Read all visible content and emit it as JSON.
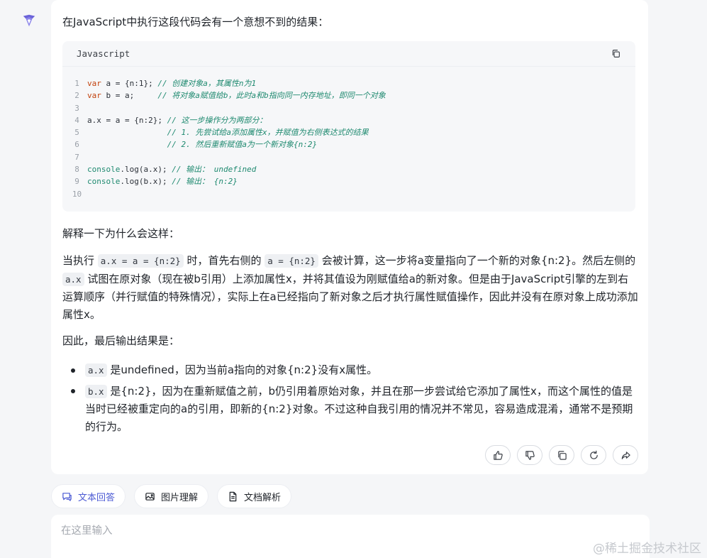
{
  "intro": "在JavaScript中执行这段代码会有一个意想不到的结果：",
  "code": {
    "language": "Javascript",
    "lines": [
      {
        "n": "1",
        "kw": "var",
        "code": " a = {n:1}; ",
        "comment": "// 创建对象a，其属性n为1"
      },
      {
        "n": "2",
        "kw": "var",
        "code": " b = a;     ",
        "comment": "// 将对象a赋值给b，此时a和b指向同一内存地址，即同一个对象"
      },
      {
        "n": "3",
        "kw": "",
        "code": "",
        "comment": ""
      },
      {
        "n": "4",
        "kw": "",
        "code": "a.x = a = {n:2}; ",
        "comment": "// 这一步操作分为两部分："
      },
      {
        "n": "5",
        "kw": "",
        "code": "                 ",
        "comment": "// 1. 先尝试给a添加属性x，并赋值为右侧表达式的结果"
      },
      {
        "n": "6",
        "kw": "",
        "code": "                 ",
        "comment": "// 2. 然后重新赋值a为一个新对象{n:2}"
      },
      {
        "n": "7",
        "kw": "",
        "code": "",
        "comment": ""
      },
      {
        "n": "8",
        "kw": "",
        "fn": "console",
        "code": ".log(a.x); ",
        "comment": "// 输出： undefined"
      },
      {
        "n": "9",
        "kw": "",
        "fn": "console",
        "code": ".log(b.x); ",
        "comment": "// 输出： {n:2}"
      },
      {
        "n": "10",
        "kw": "",
        "code": "",
        "comment": ""
      }
    ]
  },
  "explain_heading": "解释一下为什么会这样：",
  "para1": {
    "t1": "当执行 ",
    "c1": "a.x = a = {n:2}",
    "t2": " 时，首先右侧的 ",
    "c2": "a = {n:2}",
    "t3": " 会被计算，这一步将a变量指向了一个新的对象{n:2}。然后左侧的 ",
    "c3": "a.x",
    "t4": " 试图在原对象（现在被b引用）上添加属性x，并将其值设为刚赋值给a的新对象。但是由于JavaScript引擎的左到右运算顺序（并行赋值的特殊情况），实际上在a已经指向了新对象之后才执行属性赋值操作，因此并没有在原对象上成功添加属性x。"
  },
  "conclusion": "因此，最后输出结果是：",
  "bullets": [
    {
      "code": "a.x",
      "text": " 是undefined，因为当前a指向的对象{n:2}没有x属性。"
    },
    {
      "code": "b.x",
      "text": " 是{n:2}，因为在重新赋值之前，b仍引用着原始对象，并且在那一步尝试给它添加了属性x，而这个属性的值是当时已经被重定向的a的引用，即新的{n:2}对象。不过这种自我引用的情况并不常见，容易造成混淆，通常不是预期的行为。"
    }
  ],
  "modes": [
    {
      "label": "文本回答",
      "icon": "chat-icon"
    },
    {
      "label": "图片理解",
      "icon": "image-icon"
    },
    {
      "label": "文档解析",
      "icon": "document-icon"
    }
  ],
  "input": {
    "placeholder": "在这里输入"
  },
  "watermark": "@稀土掘金技术社区",
  "colors": {
    "accent": "#4c5bd4",
    "background": "#f5f6f8"
  }
}
